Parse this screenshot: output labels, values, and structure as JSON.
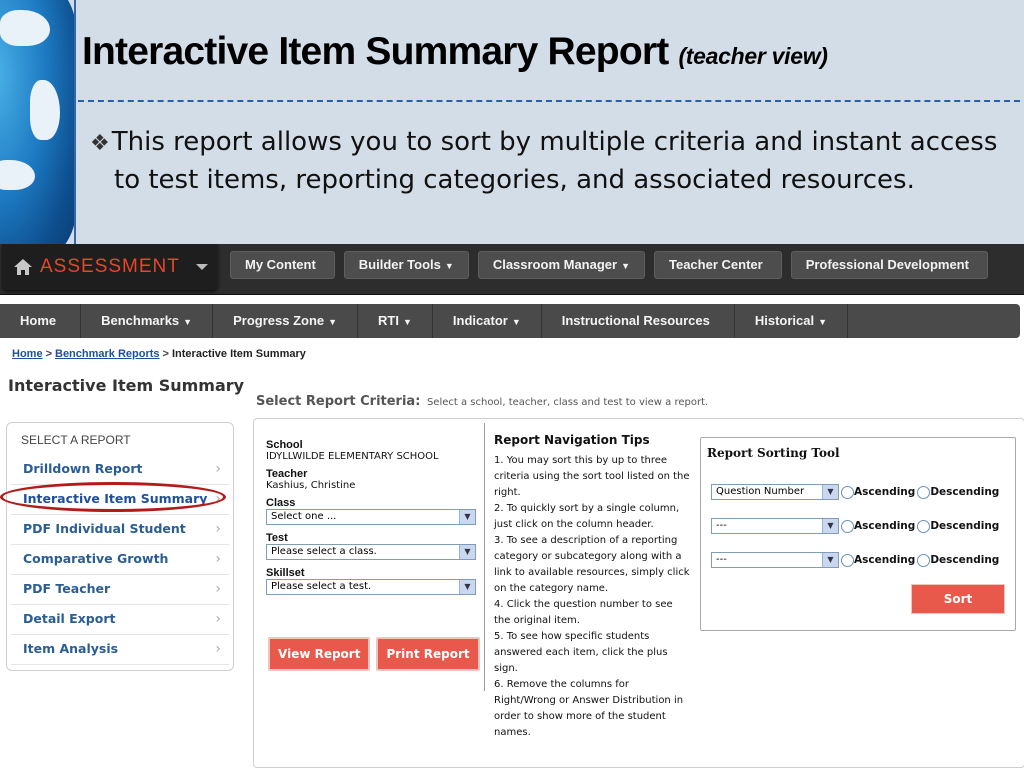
{
  "slide": {
    "title": "Interactive Item Summary Report",
    "subtitle": "(teacher view)",
    "bullet_mark": "❖",
    "bullet": "This report allows you to sort by multiple criteria and instant access to test items, reporting categories, and associated resources."
  },
  "topbar": {
    "brand": "ASSESSMENT",
    "buttons": [
      {
        "label": "My Content",
        "dropdown": ""
      },
      {
        "label": "Builder Tools",
        "dropdown": "▼"
      },
      {
        "label": "Classroom Manager",
        "dropdown": "▼"
      },
      {
        "label": "Teacher Center",
        "dropdown": ""
      },
      {
        "label": "Professional Development",
        "dropdown": ""
      }
    ]
  },
  "mainnav": [
    {
      "label": "Home",
      "dropdown": ""
    },
    {
      "label": "Benchmarks",
      "dropdown": "▼"
    },
    {
      "label": "Progress Zone",
      "dropdown": "▼"
    },
    {
      "label": "RTI",
      "dropdown": "▼"
    },
    {
      "label": "Indicator",
      "dropdown": "▼"
    },
    {
      "label": "Instructional Resources",
      "dropdown": ""
    },
    {
      "label": "Historical",
      "dropdown": "▼"
    }
  ],
  "breadcrumb": {
    "home": "Home",
    "sep": ">",
    "reports": "Benchmark Reports",
    "current": "Interactive Item Summary"
  },
  "page": {
    "title": "Interactive Item Summary",
    "criteria_title": "Select Report Criteria:",
    "criteria_hint": "Select a school, teacher, class and test to view a report."
  },
  "sidebar": {
    "heading": "SELECT A REPORT",
    "chevron": "›",
    "items": [
      {
        "label": "Drilldown Report"
      },
      {
        "label": "Interactive Item Summary"
      },
      {
        "label": "PDF Individual Student"
      },
      {
        "label": "Comparative Growth"
      },
      {
        "label": "PDF Teacher"
      },
      {
        "label": "Detail Export"
      },
      {
        "label": "Item Analysis"
      }
    ]
  },
  "form": {
    "school_label": "School",
    "school_value": "IDYLLWILDE ELEMENTARY SCHOOL",
    "teacher_label": "Teacher",
    "teacher_value": "Kashius, Christine",
    "class_label": "Class",
    "class_value": "Select one ...",
    "test_label": "Test",
    "test_value": "Please select a class.",
    "skillset_label": "Skillset",
    "skillset_value": "Please select a test.",
    "view_button": "View Report",
    "print_button": "Print Report"
  },
  "tips": {
    "heading": "Report Navigation Tips",
    "items": [
      "1.  You may sort this by up to three criteria using the sort tool listed on the right.",
      "2.  To quickly sort by a single column, just click on the column header.",
      "3.  To see a description of a reporting category or subcategory along with a link to available resources, simply click on the category name.",
      "4.  Click the question number to see the original item.",
      "5.  To see how specific students answered each item, click the plus sign.",
      "6.  Remove the columns for Right/Wrong or Answer Distribution in order to show more of the student names."
    ]
  },
  "sorter": {
    "heading": "Report Sorting Tool",
    "ascending": "Ascending",
    "descending": "Descending",
    "rows": [
      {
        "value": "Question Number"
      },
      {
        "value": "---"
      },
      {
        "value": "---"
      }
    ],
    "sort_button": "Sort"
  },
  "colors": {
    "brand": "#e8452a",
    "button_red": "#e8584b",
    "link_blue": "#2a5d93",
    "highlight_ring": "#b41a1a"
  },
  "icons": {
    "home": "home-icon",
    "select_arrow": "select-arrow-icon",
    "chevron": "chevron-right-icon"
  }
}
